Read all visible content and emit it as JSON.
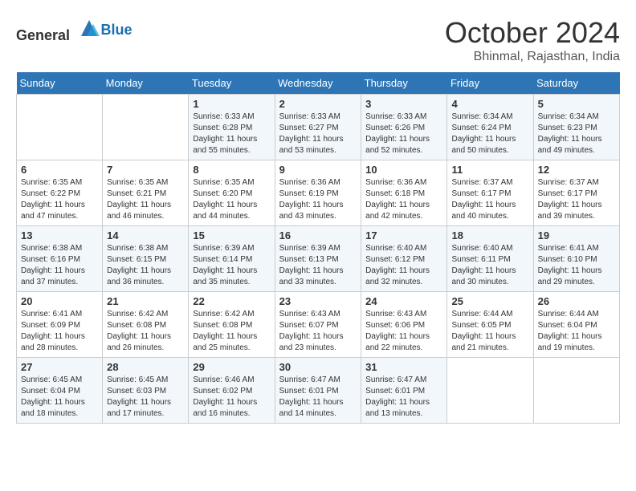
{
  "logo": {
    "general": "General",
    "blue": "Blue"
  },
  "title": "October 2024",
  "location": "Bhinmal, Rajasthan, India",
  "days_of_week": [
    "Sunday",
    "Monday",
    "Tuesday",
    "Wednesday",
    "Thursday",
    "Friday",
    "Saturday"
  ],
  "weeks": [
    [
      {
        "day": "",
        "sunrise": "",
        "sunset": "",
        "daylight": ""
      },
      {
        "day": "",
        "sunrise": "",
        "sunset": "",
        "daylight": ""
      },
      {
        "day": "1",
        "sunrise": "Sunrise: 6:33 AM",
        "sunset": "Sunset: 6:28 PM",
        "daylight": "Daylight: 11 hours and 55 minutes."
      },
      {
        "day": "2",
        "sunrise": "Sunrise: 6:33 AM",
        "sunset": "Sunset: 6:27 PM",
        "daylight": "Daylight: 11 hours and 53 minutes."
      },
      {
        "day": "3",
        "sunrise": "Sunrise: 6:33 AM",
        "sunset": "Sunset: 6:26 PM",
        "daylight": "Daylight: 11 hours and 52 minutes."
      },
      {
        "day": "4",
        "sunrise": "Sunrise: 6:34 AM",
        "sunset": "Sunset: 6:24 PM",
        "daylight": "Daylight: 11 hours and 50 minutes."
      },
      {
        "day": "5",
        "sunrise": "Sunrise: 6:34 AM",
        "sunset": "Sunset: 6:23 PM",
        "daylight": "Daylight: 11 hours and 49 minutes."
      }
    ],
    [
      {
        "day": "6",
        "sunrise": "Sunrise: 6:35 AM",
        "sunset": "Sunset: 6:22 PM",
        "daylight": "Daylight: 11 hours and 47 minutes."
      },
      {
        "day": "7",
        "sunrise": "Sunrise: 6:35 AM",
        "sunset": "Sunset: 6:21 PM",
        "daylight": "Daylight: 11 hours and 46 minutes."
      },
      {
        "day": "8",
        "sunrise": "Sunrise: 6:35 AM",
        "sunset": "Sunset: 6:20 PM",
        "daylight": "Daylight: 11 hours and 44 minutes."
      },
      {
        "day": "9",
        "sunrise": "Sunrise: 6:36 AM",
        "sunset": "Sunset: 6:19 PM",
        "daylight": "Daylight: 11 hours and 43 minutes."
      },
      {
        "day": "10",
        "sunrise": "Sunrise: 6:36 AM",
        "sunset": "Sunset: 6:18 PM",
        "daylight": "Daylight: 11 hours and 42 minutes."
      },
      {
        "day": "11",
        "sunrise": "Sunrise: 6:37 AM",
        "sunset": "Sunset: 6:17 PM",
        "daylight": "Daylight: 11 hours and 40 minutes."
      },
      {
        "day": "12",
        "sunrise": "Sunrise: 6:37 AM",
        "sunset": "Sunset: 6:17 PM",
        "daylight": "Daylight: 11 hours and 39 minutes."
      }
    ],
    [
      {
        "day": "13",
        "sunrise": "Sunrise: 6:38 AM",
        "sunset": "Sunset: 6:16 PM",
        "daylight": "Daylight: 11 hours and 37 minutes."
      },
      {
        "day": "14",
        "sunrise": "Sunrise: 6:38 AM",
        "sunset": "Sunset: 6:15 PM",
        "daylight": "Daylight: 11 hours and 36 minutes."
      },
      {
        "day": "15",
        "sunrise": "Sunrise: 6:39 AM",
        "sunset": "Sunset: 6:14 PM",
        "daylight": "Daylight: 11 hours and 35 minutes."
      },
      {
        "day": "16",
        "sunrise": "Sunrise: 6:39 AM",
        "sunset": "Sunset: 6:13 PM",
        "daylight": "Daylight: 11 hours and 33 minutes."
      },
      {
        "day": "17",
        "sunrise": "Sunrise: 6:40 AM",
        "sunset": "Sunset: 6:12 PM",
        "daylight": "Daylight: 11 hours and 32 minutes."
      },
      {
        "day": "18",
        "sunrise": "Sunrise: 6:40 AM",
        "sunset": "Sunset: 6:11 PM",
        "daylight": "Daylight: 11 hours and 30 minutes."
      },
      {
        "day": "19",
        "sunrise": "Sunrise: 6:41 AM",
        "sunset": "Sunset: 6:10 PM",
        "daylight": "Daylight: 11 hours and 29 minutes."
      }
    ],
    [
      {
        "day": "20",
        "sunrise": "Sunrise: 6:41 AM",
        "sunset": "Sunset: 6:09 PM",
        "daylight": "Daylight: 11 hours and 28 minutes."
      },
      {
        "day": "21",
        "sunrise": "Sunrise: 6:42 AM",
        "sunset": "Sunset: 6:08 PM",
        "daylight": "Daylight: 11 hours and 26 minutes."
      },
      {
        "day": "22",
        "sunrise": "Sunrise: 6:42 AM",
        "sunset": "Sunset: 6:08 PM",
        "daylight": "Daylight: 11 hours and 25 minutes."
      },
      {
        "day": "23",
        "sunrise": "Sunrise: 6:43 AM",
        "sunset": "Sunset: 6:07 PM",
        "daylight": "Daylight: 11 hours and 23 minutes."
      },
      {
        "day": "24",
        "sunrise": "Sunrise: 6:43 AM",
        "sunset": "Sunset: 6:06 PM",
        "daylight": "Daylight: 11 hours and 22 minutes."
      },
      {
        "day": "25",
        "sunrise": "Sunrise: 6:44 AM",
        "sunset": "Sunset: 6:05 PM",
        "daylight": "Daylight: 11 hours and 21 minutes."
      },
      {
        "day": "26",
        "sunrise": "Sunrise: 6:44 AM",
        "sunset": "Sunset: 6:04 PM",
        "daylight": "Daylight: 11 hours and 19 minutes."
      }
    ],
    [
      {
        "day": "27",
        "sunrise": "Sunrise: 6:45 AM",
        "sunset": "Sunset: 6:04 PM",
        "daylight": "Daylight: 11 hours and 18 minutes."
      },
      {
        "day": "28",
        "sunrise": "Sunrise: 6:45 AM",
        "sunset": "Sunset: 6:03 PM",
        "daylight": "Daylight: 11 hours and 17 minutes."
      },
      {
        "day": "29",
        "sunrise": "Sunrise: 6:46 AM",
        "sunset": "Sunset: 6:02 PM",
        "daylight": "Daylight: 11 hours and 16 minutes."
      },
      {
        "day": "30",
        "sunrise": "Sunrise: 6:47 AM",
        "sunset": "Sunset: 6:01 PM",
        "daylight": "Daylight: 11 hours and 14 minutes."
      },
      {
        "day": "31",
        "sunrise": "Sunrise: 6:47 AM",
        "sunset": "Sunset: 6:01 PM",
        "daylight": "Daylight: 11 hours and 13 minutes."
      },
      {
        "day": "",
        "sunrise": "",
        "sunset": "",
        "daylight": ""
      },
      {
        "day": "",
        "sunrise": "",
        "sunset": "",
        "daylight": ""
      }
    ]
  ]
}
